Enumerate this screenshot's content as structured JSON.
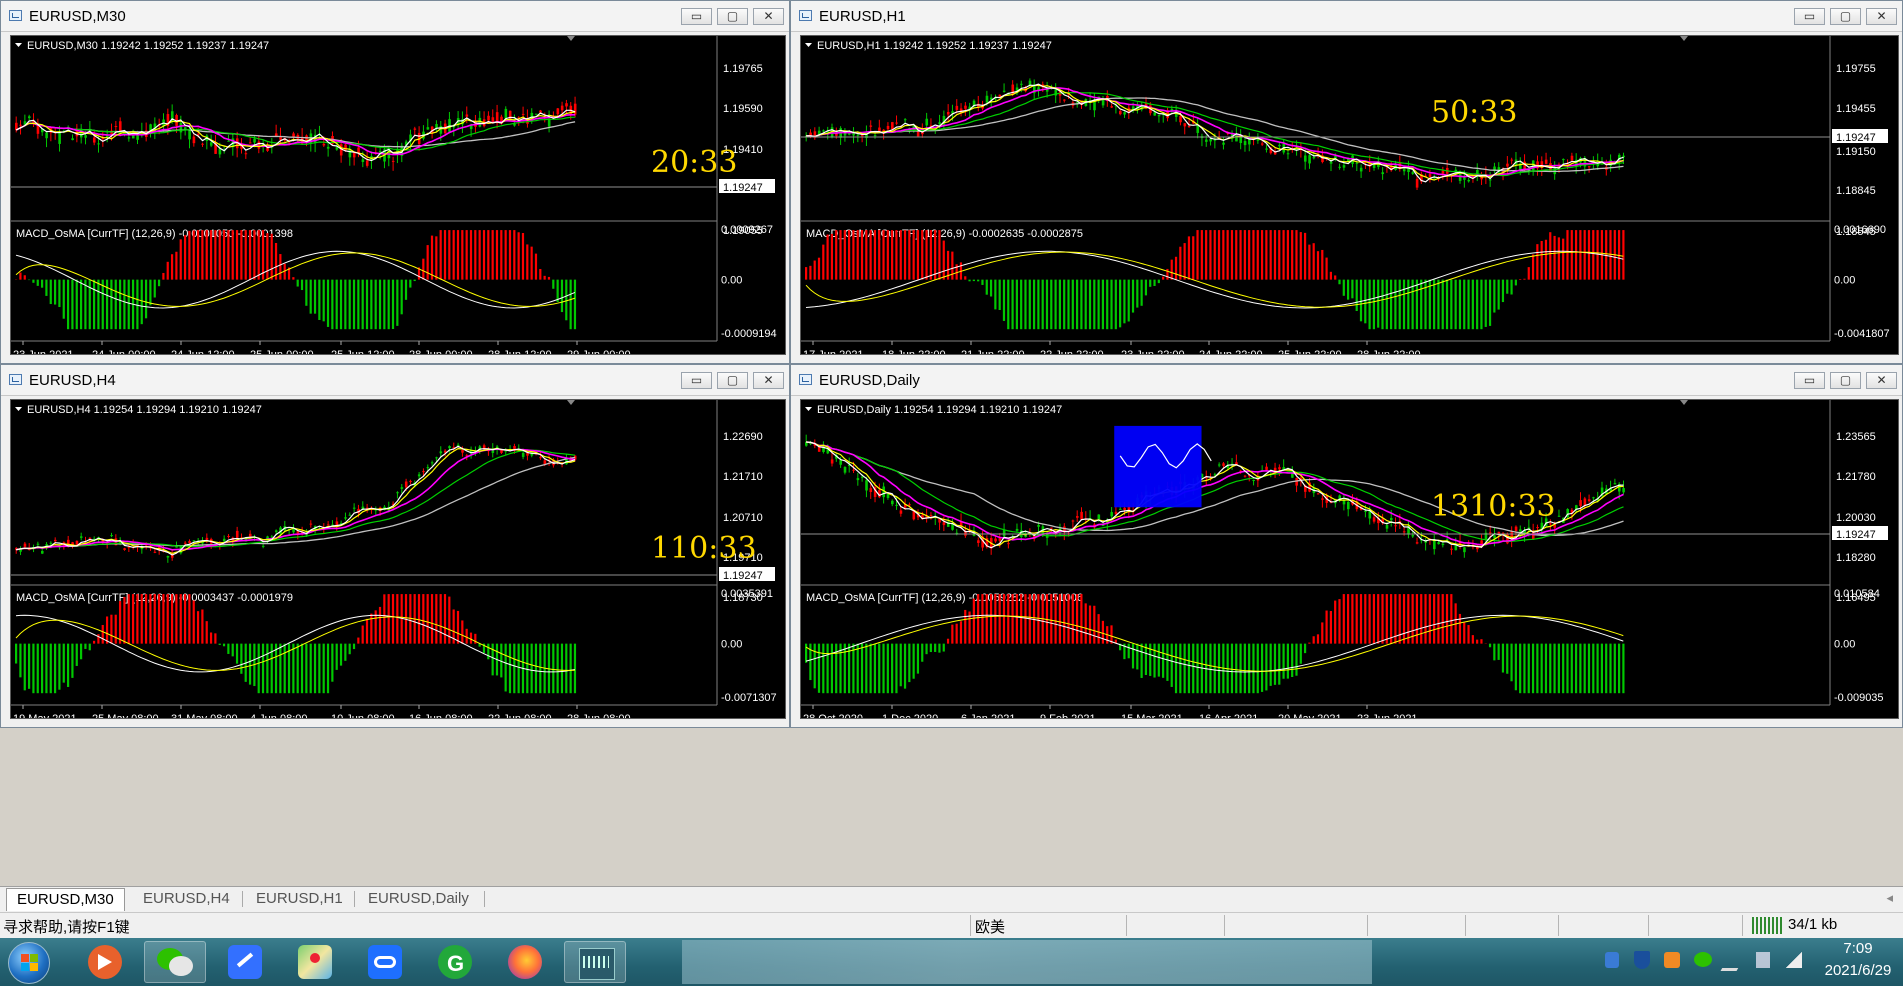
{
  "windows": [
    {
      "id": "m30",
      "title": "EURUSD,M30",
      "header": "EURUSD,M30  1.19242 1.19252 1.19237 1.19247",
      "price_labels": [
        "1.19765",
        "1.19590",
        "1.19410",
        "1.19247",
        "1.19055"
      ],
      "current_price": "1.19247",
      "indicator": "MACD_OsMA [CurrTF] (12,26,9) -0.0001050 -0.0001398",
      "indicator_labels": [
        "0.0009267",
        "0.00",
        "-0.0009194"
      ],
      "time_labels": [
        "23 Jun 2021",
        "24 Jun 00:00",
        "24 Jun 12:00",
        "25 Jun 00:00",
        "25 Jun 12:00",
        "28 Jun 00:00",
        "28 Jun 12:00",
        "29 Jun 00:00"
      ],
      "countdown": "20:33"
    },
    {
      "id": "h1",
      "title": "EURUSD,H1",
      "header": "EURUSD,H1  1.19242 1.19252 1.19237 1.19247",
      "price_labels": [
        "1.19755",
        "1.19455",
        "1.19247",
        "1.19150",
        "1.18845",
        "1.18545"
      ],
      "current_price": "1.19247",
      "indicator": "MACD_OsMA [CurrTF] (12,26,9) -0.0002635 -0.0002875",
      "indicator_labels": [
        "0.0016690",
        "0.00",
        "-0.0041807"
      ],
      "time_labels": [
        "17 Jun 2021",
        "18 Jun 22:00",
        "21 Jun 22:00",
        "22 Jun 22:00",
        "23 Jun 22:00",
        "24 Jun 22:00",
        "25 Jun 22:00",
        "28 Jun 22:00"
      ],
      "countdown": "50:33"
    },
    {
      "id": "h4",
      "title": "EURUSD,H4",
      "header": "EURUSD,H4  1.19254 1.19294 1.19210 1.19247",
      "price_labels": [
        "1.22690",
        "1.21710",
        "1.20710",
        "1.19710",
        "1.19247",
        "1.18730"
      ],
      "current_price": "1.19247",
      "indicator": "MACD_OsMA [CurrTF] (12,26,9) -0.0003437 -0.0001979",
      "indicator_labels": [
        "0.0035391",
        "0.00",
        "-0.0071307"
      ],
      "time_labels": [
        "19 May 2021",
        "25 May 08:00",
        "31 May 08:00",
        "4 Jun 08:00",
        "10 Jun 08:00",
        "16 Jun 08:00",
        "22 Jun 08:00",
        "28 Jun 08:00"
      ],
      "countdown": "110:33"
    },
    {
      "id": "daily",
      "title": "EURUSD,Daily",
      "header": "EURUSD,Daily  1.19254 1.19294 1.19210 1.19247",
      "price_labels": [
        "1.23565",
        "1.21780",
        "1.20030",
        "1.19247",
        "1.18280",
        "1.16495"
      ],
      "current_price": "1.19247",
      "indicator": "MACD_OsMA [CurrTF] (12,26,9) -0.0059282 -0.0051006",
      "indicator_labels": [
        "0.010584",
        "0.00",
        "-0.009035"
      ],
      "time_labels": [
        "28 Oct 2020",
        "1 Dec 2020",
        "6 Jan 2021",
        "9 Feb 2021",
        "15 Mar 2021",
        "16 Apr 2021",
        "20 May 2021",
        "23 Jun 2021"
      ],
      "countdown": "1310:33"
    }
  ],
  "window_buttons": {
    "minimize": "▭",
    "maximize": "▢",
    "close": "✕"
  },
  "tabs": [
    "EURUSD,M30",
    "EURUSD,H4",
    "EURUSD,H1",
    "EURUSD,Daily"
  ],
  "active_tab": "EURUSD,M30",
  "status": {
    "help": "寻求帮助,请按F1键",
    "profile": "欧美",
    "traffic": "34/1 kb"
  },
  "taskbar": {
    "clock_time": "7:09",
    "clock_date": "2021/6/29",
    "apps": [
      "start-orb",
      "video-app",
      "wechat",
      "feishu",
      "maps",
      "tencent-meeting",
      "green-app",
      "firefox",
      "mt4-terminal"
    ]
  },
  "colors": {
    "candle_up": "#00c800",
    "candle_down": "#ff0000",
    "ma_white": "#ffffff",
    "ma_yellow": "#ffff00",
    "ma_magenta": "#ff00ff",
    "ma_green": "#00d000",
    "ma_gray": "#c0c0c0",
    "countdown": "#ffd800",
    "highlight_box": "#0000ff"
  }
}
